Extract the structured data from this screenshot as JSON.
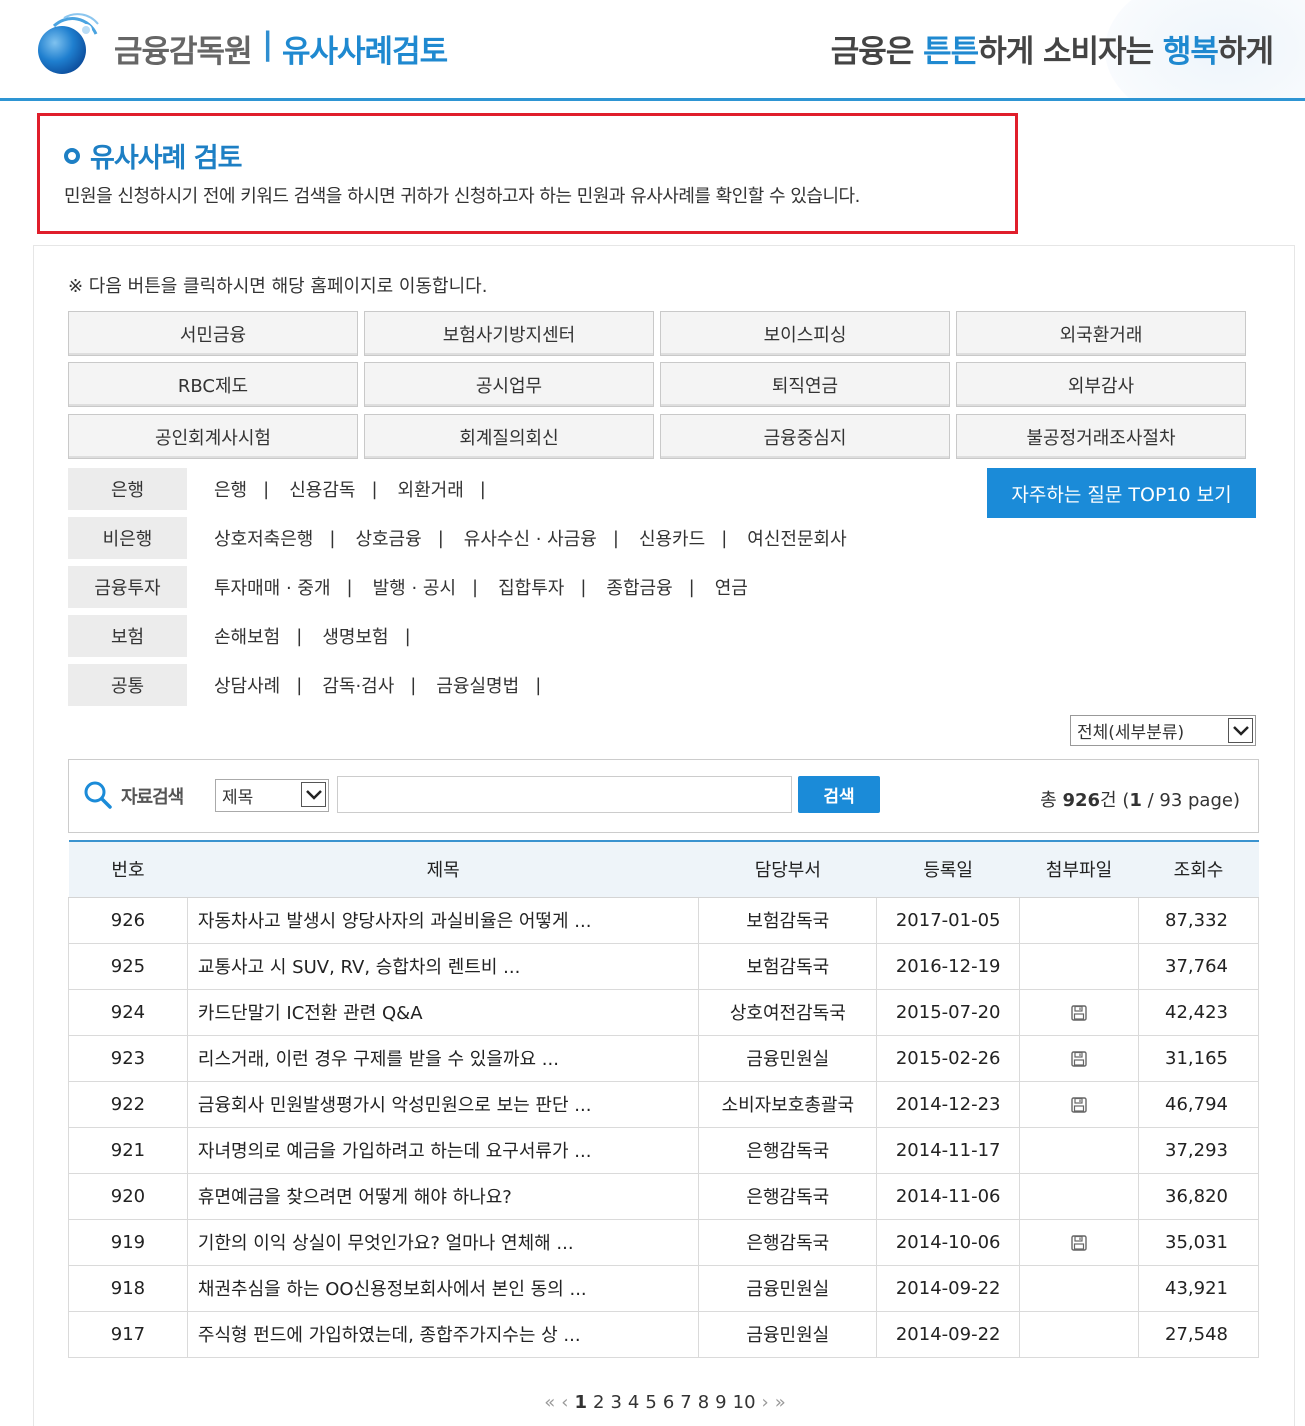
{
  "header": {
    "brand": "금융감독원",
    "separator": "|",
    "subtitle": "유사사례검토",
    "slogan_part1": "금융은 ",
    "slogan_hl1": "튼튼",
    "slogan_part2": "하게 소비자는 ",
    "slogan_hl2": "행복",
    "slogan_part3": "하게"
  },
  "intro": {
    "title": "유사사례 검토",
    "description": "민원을 신청하시기 전에 키워드 검색을 하시면 귀하가 신청하고자 하는 민원과 유사사례를 확인할 수 있습니다."
  },
  "notice": "※ 다음 버튼을 클릭하시면 해당 홈페이지로 이동합니다.",
  "quick_buttons": [
    [
      "서민금융",
      "보험사기방지센터",
      "보이스피싱",
      "외국환거래"
    ],
    [
      "RBC제도",
      "공시업무",
      "퇴직연금",
      "외부감사"
    ],
    [
      "공인회계사시험",
      "회계질의회신",
      "금융중심지",
      "불공정거래조사절차"
    ]
  ],
  "categories": [
    {
      "label": "은행",
      "links": [
        "은행",
        "신용감독",
        "외환거래"
      ],
      "trailing_bar": true
    },
    {
      "label": "비은행",
      "links": [
        "상호저축은행",
        "상호금융",
        "유사수신 · 사금융",
        "신용카드",
        "여신전문회사"
      ],
      "trailing_bar": false
    },
    {
      "label": "금융투자",
      "links": [
        "투자매매 · 중개",
        "발행 · 공시",
        "집합투자",
        "종합금융",
        "연금"
      ],
      "trailing_bar": false
    },
    {
      "label": "보험",
      "links": [
        "손해보험",
        "생명보험"
      ],
      "trailing_bar": true
    },
    {
      "label": "공통",
      "links": [
        "상담사례",
        "감독·검사",
        "금융실명법"
      ],
      "trailing_bar": true
    }
  ],
  "faq_button": "자주하는 질문 TOP10 보기",
  "subcategory_select": "전체(세부분류)",
  "search": {
    "label": "자료검색",
    "field_select": "제목",
    "input_value": "",
    "button": "검색",
    "count_prefix": "총 ",
    "count_total": "926",
    "count_unit": "건 (",
    "current_page": "1",
    "page_sep": " / 93 page)"
  },
  "table": {
    "columns": [
      "번호",
      "제목",
      "담당부서",
      "등록일",
      "첨부파일",
      "조회수"
    ],
    "rows": [
      {
        "no": "926",
        "title": "자동차사고 발생시 양당사자의 과실비율은 어떻게 ...",
        "dept": "보험감독국",
        "date": "2017-01-05",
        "attach": false,
        "views": "87,332"
      },
      {
        "no": "925",
        "title": "교통사고 시 SUV, RV, 승합차의 렌트비 ...",
        "dept": "보험감독국",
        "date": "2016-12-19",
        "attach": false,
        "views": "37,764"
      },
      {
        "no": "924",
        "title": "카드단말기 IC전환 관련 Q&A",
        "dept": "상호여전감독국",
        "date": "2015-07-20",
        "attach": true,
        "views": "42,423"
      },
      {
        "no": "923",
        "title": "리스거래, 이런 경우 구제를 받을 수 있을까요 ...",
        "dept": "금융민원실",
        "date": "2015-02-26",
        "attach": true,
        "views": "31,165"
      },
      {
        "no": "922",
        "title": "금융회사 민원발생평가시 악성민원으로 보는 판단 ...",
        "dept": "소비자보호총괄국",
        "date": "2014-12-23",
        "attach": true,
        "views": "46,794"
      },
      {
        "no": "921",
        "title": "자녀명의로 예금을 가입하려고 하는데 요구서류가 ...",
        "dept": "은행감독국",
        "date": "2014-11-17",
        "attach": false,
        "views": "37,293"
      },
      {
        "no": "920",
        "title": "휴면예금을 찾으려면 어떻게 해야 하나요?",
        "dept": "은행감독국",
        "date": "2014-11-06",
        "attach": false,
        "views": "36,820"
      },
      {
        "no": "919",
        "title": "기한의 이익 상실이 무엇인가요? 얼마나 연체해 ...",
        "dept": "은행감독국",
        "date": "2014-10-06",
        "attach": true,
        "views": "35,031"
      },
      {
        "no": "918",
        "title": "채권추심을 하는 OO신용정보회사에서 본인 동의 ...",
        "dept": "금융민원실",
        "date": "2014-09-22",
        "attach": false,
        "views": "43,921"
      },
      {
        "no": "917",
        "title": "주식형 펀드에 가입하였는데, 종합주가지수는 상 ...",
        "dept": "금융민원실",
        "date": "2014-09-22",
        "attach": false,
        "views": "27,548"
      }
    ]
  },
  "pagination": {
    "first": "«",
    "prev": "‹",
    "pages": [
      "1",
      "2",
      "3",
      "4",
      "5",
      "6",
      "7",
      "8",
      "9",
      "10"
    ],
    "current": "1",
    "next": "›",
    "last": "»"
  },
  "colors": {
    "accent": "#1b8bd8",
    "intro_border": "#e01e2b",
    "header_line": "#2e95d3"
  }
}
